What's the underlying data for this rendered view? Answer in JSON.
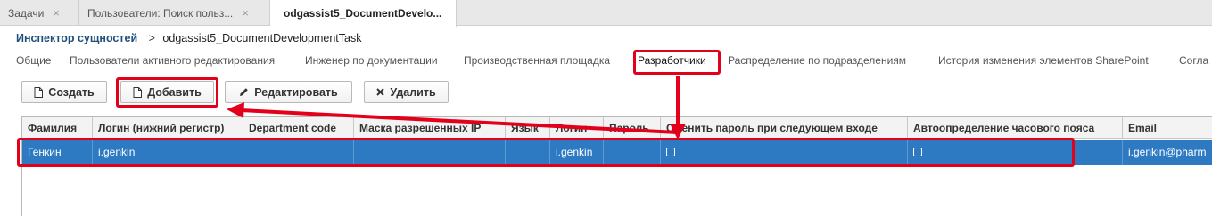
{
  "window_tabs": [
    {
      "label": "Задачи",
      "close": "×"
    },
    {
      "label": "Пользователи: Поиск польз...",
      "close": "×"
    },
    {
      "label": "odgassist5_DocumentDevelo...",
      "close": ""
    }
  ],
  "breadcrumb": {
    "link": "Инспектор сущностей",
    "separator": ">",
    "current": "odgassist5_DocumentDevelopmentTask"
  },
  "section_tabs": [
    {
      "label": "Общие"
    },
    {
      "label": "Пользователи активного редактирования"
    },
    {
      "label": "Инженер по документации"
    },
    {
      "label": "Производственная площадка"
    },
    {
      "label": "Разработчики",
      "active": true
    },
    {
      "label": "Распределение по подразделениям"
    },
    {
      "label": "История изменения элементов SharePoint"
    },
    {
      "label": "Согла"
    }
  ],
  "toolbar": {
    "create_label": "Создать",
    "add_label": "Добавить",
    "edit_label": "Редактировать",
    "delete_label": "Удалить"
  },
  "table": {
    "columns": [
      "Фамилия",
      "Логин (нижний регистр)",
      "Department code",
      "Маска разрешенных IP",
      "Язык",
      "Логин",
      "Пароль",
      "Сменить пароль при следующем входе",
      "Автоопределение часового пояса",
      "Email"
    ],
    "rows": [
      {
        "surname": "Генкин",
        "login_lower": "i.genkin",
        "department_code": "",
        "ip_mask": "",
        "language": "",
        "login": "i.genkin",
        "password": "",
        "change_password_next_login": false,
        "timezone_autodetect": false,
        "email": "i.genkin@pharm"
      }
    ]
  },
  "colors": {
    "selected_row": "#2d7ac3",
    "annotation_red": "#e3001b",
    "link_blue": "#1f4e79"
  },
  "icons": {
    "create": "document-icon",
    "add": "document-icon",
    "edit": "pencil-icon",
    "delete": "x-icon"
  }
}
